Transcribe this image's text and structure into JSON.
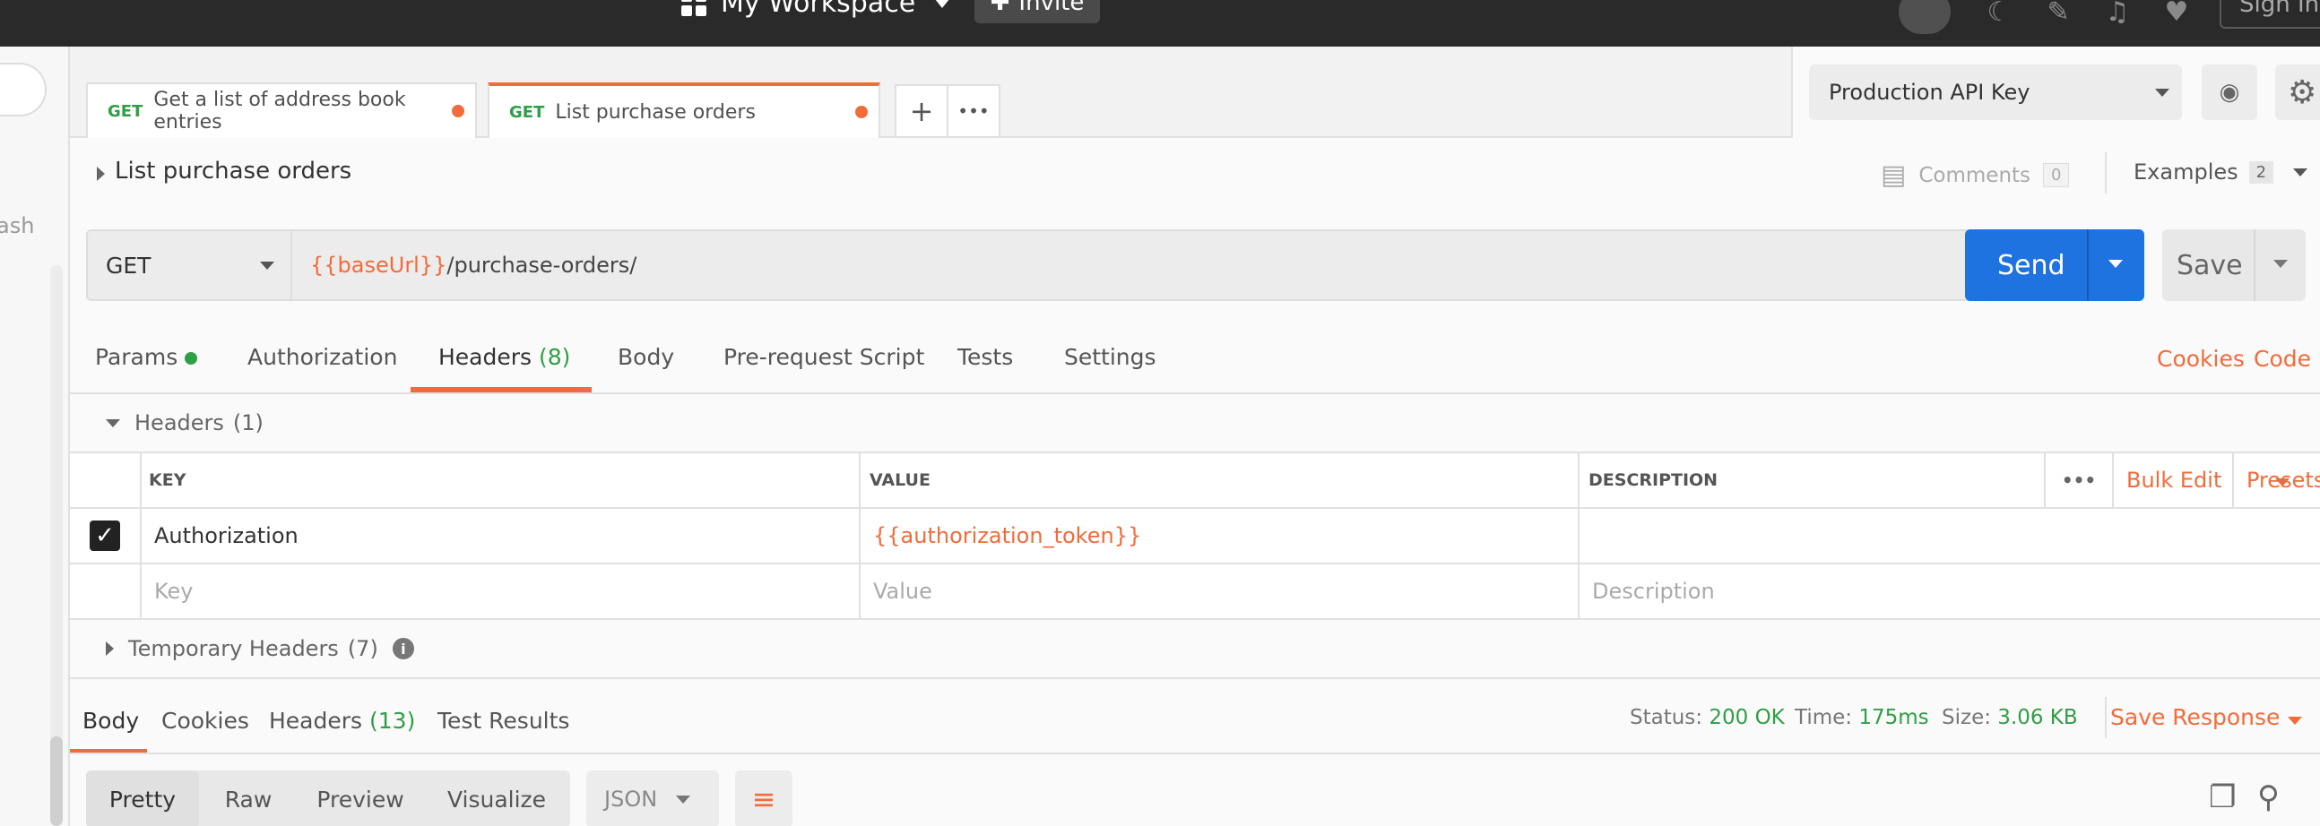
{
  "topbar": {
    "workspace": "My Workspace",
    "invite": "Invite",
    "signin": "Sign In"
  },
  "sidebar": {
    "partial_text": "ash"
  },
  "tabs": [
    {
      "method": "GET",
      "name": "Get a list of address book entries"
    },
    {
      "method": "GET",
      "name": "List purchase orders"
    }
  ],
  "tab_buttons": {
    "add": "+",
    "more": "•••"
  },
  "environment": {
    "selected": "Production API Key"
  },
  "request": {
    "title": "List purchase orders",
    "comments_label": "Comments",
    "comments_count": "0",
    "examples_label": "Examples",
    "examples_count": "2",
    "method": "GET",
    "url_var": "{{baseUrl}}",
    "url_path": "/purchase-orders/",
    "send": "Send",
    "save": "Save"
  },
  "req_tabs": {
    "params": "Params",
    "authorization": "Authorization",
    "headers": "Headers",
    "headers_count": "(8)",
    "body": "Body",
    "prerequest": "Pre-request Script",
    "tests": "Tests",
    "settings": "Settings",
    "cookies": "Cookies",
    "code": "Code"
  },
  "headers_section": {
    "title": "Headers",
    "count": "(1)",
    "col_key": "KEY",
    "col_value": "VALUE",
    "col_description": "DESCRIPTION",
    "more": "•••",
    "bulk_edit": "Bulk Edit",
    "presets": "Presets",
    "rows": [
      {
        "key": "Authorization",
        "value": "{{authorization_token}}",
        "description": ""
      }
    ],
    "placeholder_key": "Key",
    "placeholder_value": "Value",
    "placeholder_description": "Description",
    "temp_title": "Temporary Headers",
    "temp_count": "(7)"
  },
  "response": {
    "tabs": {
      "body": "Body",
      "cookies": "Cookies",
      "headers": "Headers",
      "headers_count": "(13)",
      "test_results": "Test Results"
    },
    "status_label": "Status:",
    "status_value": "200 OK",
    "time_label": "Time:",
    "time_value": "175ms",
    "size_label": "Size:",
    "size_value": "3.06 KB",
    "save_response": "Save Response",
    "formats": [
      "Pretty",
      "Raw",
      "Preview",
      "Visualize"
    ],
    "language": "JSON"
  },
  "colors": {
    "accent": "#f26b3a",
    "send": "#1f73e0",
    "green": "#2f9e44"
  }
}
